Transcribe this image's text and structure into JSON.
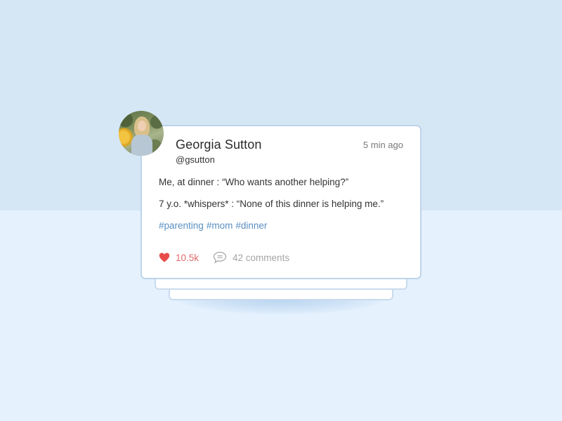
{
  "post": {
    "author_name": "Georgia Sutton",
    "handle": "@gsutton",
    "timestamp": "5 min ago",
    "lines": [
      "Me, at dinner : “Who wants another helping?”",
      "7 y.o. *whispers* : “None of this dinner is helping me.”"
    ],
    "hashtags": [
      "#parenting",
      "#mom",
      "#dinner"
    ],
    "likes": "10.5k",
    "comments": "42 comments"
  },
  "icons": {
    "like": "heart-icon",
    "comment": "speech-bubble-icon"
  },
  "colors": {
    "background_top": "#d5e7f5",
    "background_bottom": "#e5f1fd",
    "card_border": "#bdd4ea",
    "heart": "#e94b4b",
    "likes_text": "#e26b6b",
    "hashtag": "#5b8fc1",
    "muted_text": "#a5a5a5"
  }
}
